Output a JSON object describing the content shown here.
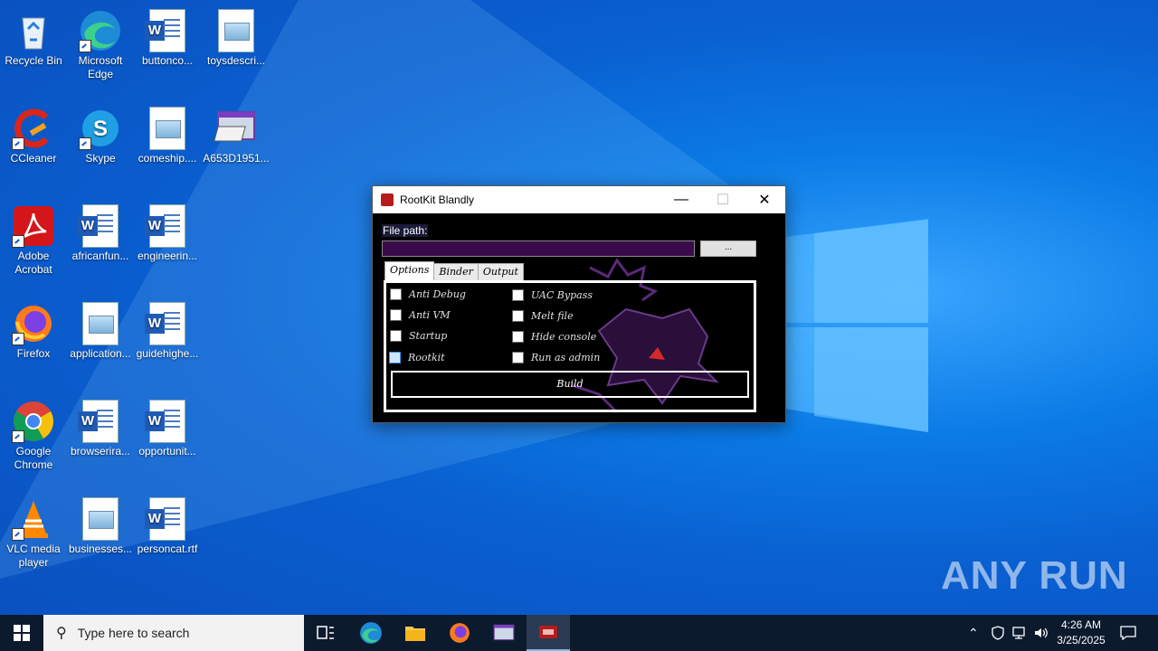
{
  "desktop": {
    "icons": [
      {
        "label": "Recycle Bin",
        "icon": "recycle-bin-icon"
      },
      {
        "label": "Microsoft Edge",
        "icon": "edge-icon"
      },
      {
        "label": "buttonco...",
        "icon": "word-doc-icon"
      },
      {
        "label": "toysdescri...",
        "icon": "image-doc-icon"
      },
      {
        "label": "CCleaner",
        "icon": "ccleaner-icon"
      },
      {
        "label": "Skype",
        "icon": "skype-icon"
      },
      {
        "label": "comeship....",
        "icon": "image-doc-icon"
      },
      {
        "label": "A653D1951...",
        "icon": "installer-icon"
      },
      {
        "label": "Adobe Acrobat",
        "icon": "acrobat-icon"
      },
      {
        "label": "africanfun...",
        "icon": "word-doc-icon"
      },
      {
        "label": "engineerin...",
        "icon": "word-doc-icon"
      },
      {
        "label": "Firefox",
        "icon": "firefox-icon"
      },
      {
        "label": "application...",
        "icon": "image-doc-icon"
      },
      {
        "label": "guidehighe...",
        "icon": "word-doc-icon"
      },
      {
        "label": "Google Chrome",
        "icon": "chrome-icon"
      },
      {
        "label": "browserira...",
        "icon": "word-doc-icon"
      },
      {
        "label": "opportunit...",
        "icon": "word-doc-icon"
      },
      {
        "label": "VLC media player",
        "icon": "vlc-icon"
      },
      {
        "label": "businesses...",
        "icon": "image-doc-icon"
      },
      {
        "label": "personcat.rtf",
        "icon": "word-doc-icon"
      }
    ]
  },
  "window": {
    "title": "RootKit Blandly",
    "file_path_label": "File path:",
    "file_path_value": "",
    "browse_label": "...",
    "tabs": [
      "Options",
      "Binder",
      "Output"
    ],
    "active_tab": "Options",
    "options": [
      {
        "label": "Anti Debug",
        "checked": false
      },
      {
        "label": "Anti VM",
        "checked": false
      },
      {
        "label": "Startup",
        "checked": false
      },
      {
        "label": "Rootkit",
        "checked": false,
        "highlighted": true
      },
      {
        "label": "UAC Bypass",
        "checked": false
      },
      {
        "label": "Melt file",
        "checked": false
      },
      {
        "label": "Hide console",
        "checked": false
      },
      {
        "label": "Run as admin",
        "checked": false
      }
    ],
    "build_label": "Build"
  },
  "watermark": "ANY RUN",
  "taskbar": {
    "search_placeholder": "Type here to search",
    "apps": [
      "task-view-icon",
      "edge-icon",
      "file-explorer-icon",
      "firefox-icon",
      "installer-icon",
      "rootkit-app-icon"
    ],
    "time": "4:26 AM",
    "date": "3/25/2025"
  },
  "colors": {
    "accent": "#0a5fd0",
    "input_bg": "#3a0a4a",
    "taskbar": "#0c1a2e"
  }
}
